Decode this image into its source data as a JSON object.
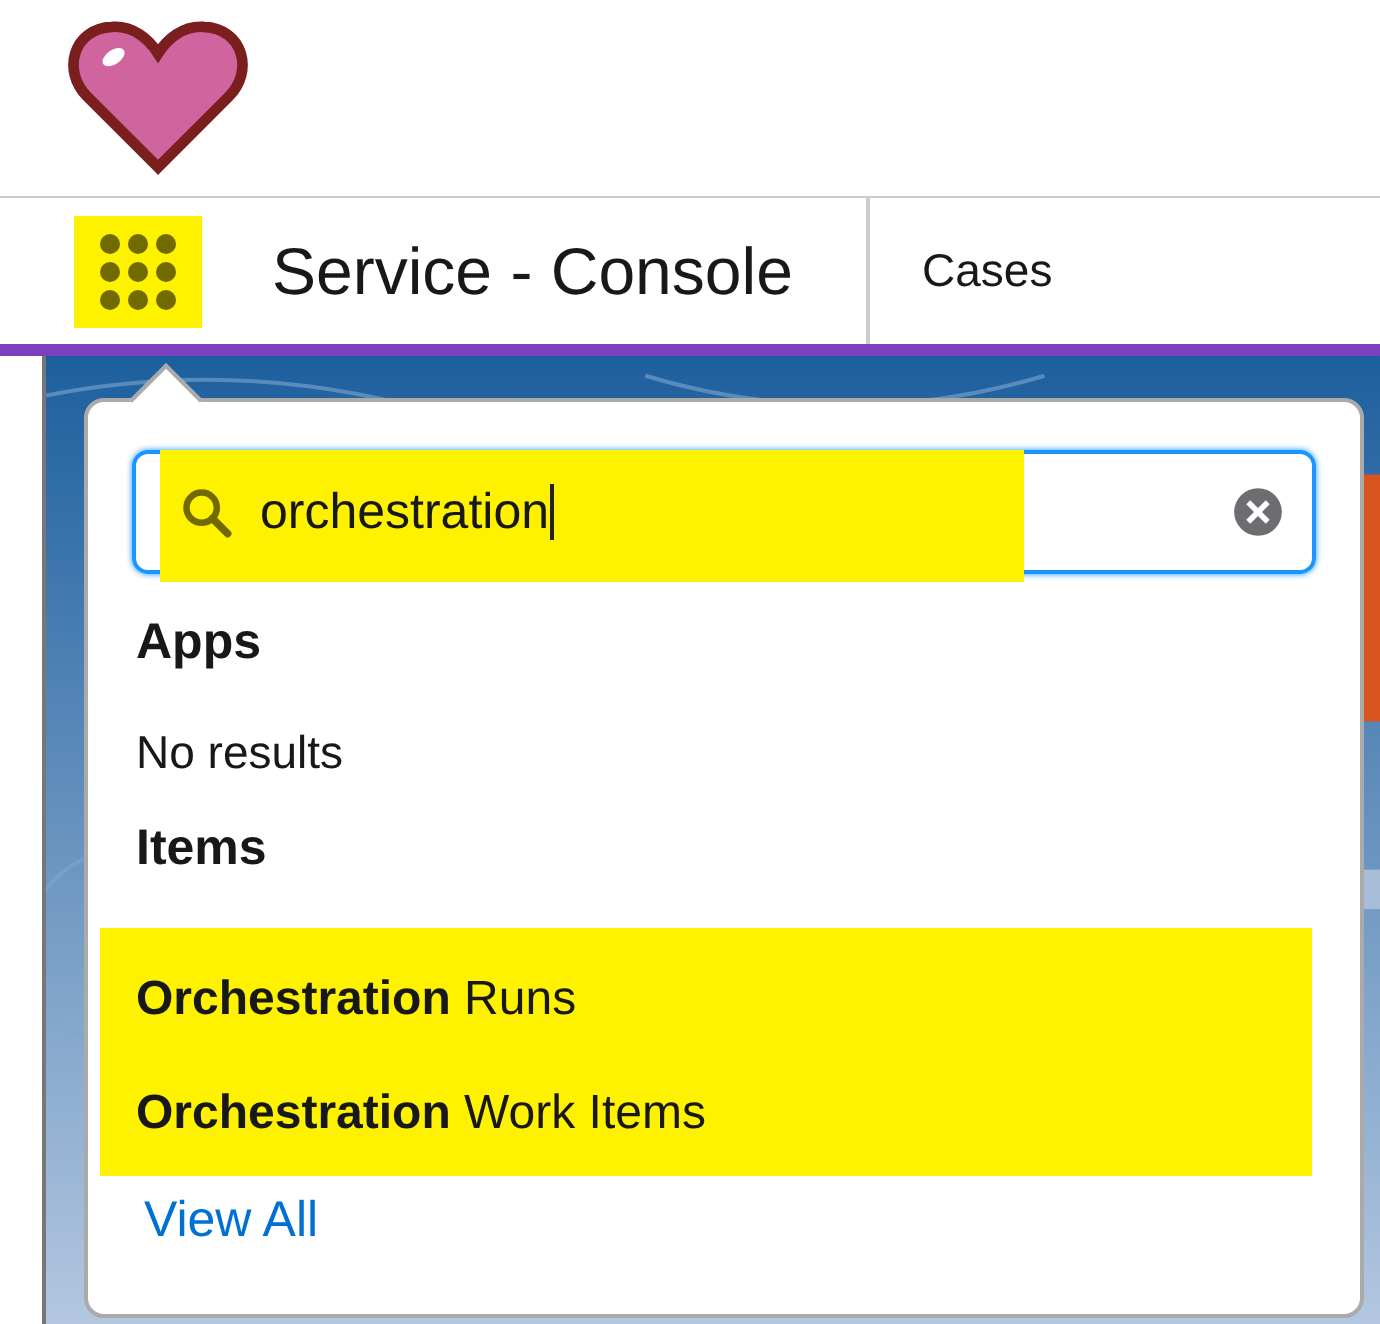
{
  "nav": {
    "app_launcher": {
      "highlighted": true
    },
    "app_title": "Service - Console",
    "tabs": [
      {
        "label": "Cases",
        "selected": false
      }
    ]
  },
  "app_launcher_popover": {
    "search": {
      "value": "orchestration",
      "highlighted": true
    },
    "sections": [
      {
        "title": "Apps",
        "empty_text": "No results"
      },
      {
        "title": "Items",
        "items": [
          {
            "label": "**Orchestration** Runs",
            "highlighted": true
          },
          {
            "label": "**Orchestration** Work Items",
            "highlighted": true
          }
        ]
      }
    ],
    "view_all": "View All"
  }
}
